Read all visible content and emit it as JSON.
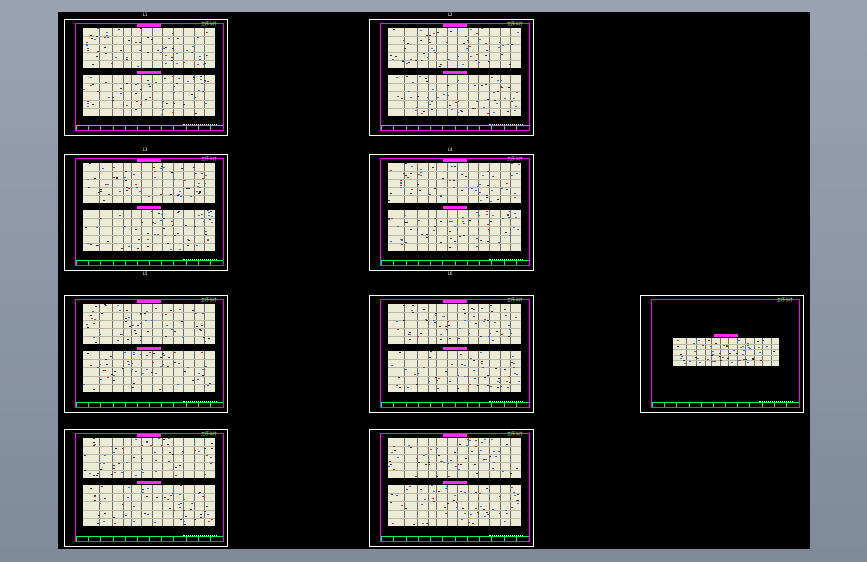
{
  "app": {
    "view": "cad-layout-overview"
  },
  "colors": {
    "background": "#000000",
    "sheet_border": "#ffffff",
    "title_frame": "#ff00ff",
    "title_bar": "#ff2bff",
    "table_fill": "#ecebd6",
    "footer_line": "#00ff66",
    "ink_blue": "#3b6fd0",
    "ink_red": "#c83232",
    "ink_dark": "#333333"
  },
  "sheets": [
    {
      "id": "sheet-1",
      "top_note": "L1",
      "header_caption": "工序卡片",
      "tables": 2
    },
    {
      "id": "sheet-2",
      "top_note": "L2",
      "header_caption": "工序卡片",
      "tables": 2
    },
    {
      "id": "sheet-3",
      "top_note": "L3",
      "header_caption": "工序卡片",
      "tables": 2
    },
    {
      "id": "sheet-4",
      "top_note": "L4",
      "header_caption": "工序卡片",
      "tables": 2
    },
    {
      "id": "sheet-5",
      "top_note": "L5",
      "header_caption": "工序卡片",
      "tables": 2
    },
    {
      "id": "sheet-6",
      "top_note": "L6",
      "header_caption": "工序卡片",
      "tables": 2
    },
    {
      "id": "sheet-7",
      "top_note": "",
      "header_caption": "工序卡片",
      "tables": 2
    },
    {
      "id": "sheet-8",
      "top_note": "",
      "header_caption": "工序卡片",
      "tables": 2
    },
    {
      "id": "sheet-9",
      "top_note": "",
      "header_caption": "工序卡片",
      "tables": 1
    }
  ]
}
